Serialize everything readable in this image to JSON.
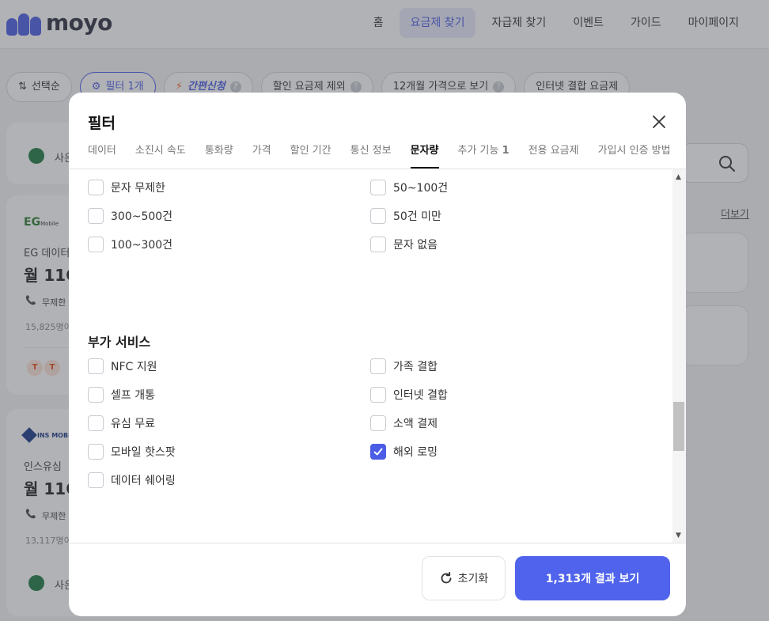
{
  "header": {
    "logo_text": "moyo",
    "nav": [
      {
        "label": "홈",
        "active": false
      },
      {
        "label": "요금제 찾기",
        "active": true
      },
      {
        "label": "자급제 찾기",
        "active": false
      },
      {
        "label": "이벤트",
        "active": false
      },
      {
        "label": "가이드",
        "active": false
      },
      {
        "label": "마이페이지",
        "active": false
      }
    ]
  },
  "chips": {
    "sort": "선택순",
    "filter": "필터 1개",
    "quick_apply": "간편신청",
    "exclude_discount": "할인 요금제 제외",
    "twelve_month": "12개월 가격으로 보기",
    "internet_bundle": "인터넷 결합 요금제"
  },
  "background": {
    "more_link": "더보기",
    "card1": {
      "sponsor_text": "사은"
    },
    "card2": {
      "brand": "EG",
      "brand_sub": "Mobile",
      "name": "EG 데이터",
      "price": "월 11G",
      "feature": "무제한",
      "users": "15,825명이"
    },
    "card3": {
      "brand": "INS MOBI",
      "name": "인스유심 ",
      "price": "월 11G",
      "feature": "무제한",
      "users": "13,117명이",
      "sponsor_text": "사은"
    }
  },
  "modal": {
    "title": "필터",
    "tabs": [
      {
        "label": "데이터",
        "active": false
      },
      {
        "label": "소진시 속도",
        "active": false
      },
      {
        "label": "통화량",
        "active": false
      },
      {
        "label": "가격",
        "active": false
      },
      {
        "label": "할인 기간",
        "active": false
      },
      {
        "label": "통신 정보",
        "active": false
      },
      {
        "label": "문자량",
        "active": true
      },
      {
        "label": "추가 기능",
        "count": "1",
        "active": false
      },
      {
        "label": "전용 요금제",
        "active": false
      },
      {
        "label": "가입시 인증 방법",
        "active": false
      }
    ],
    "sms_options": [
      {
        "label": "문자 무제한",
        "checked": false
      },
      {
        "label": "50~100건",
        "checked": false
      },
      {
        "label": "300~500건",
        "checked": false
      },
      {
        "label": "50건 미만",
        "checked": false
      },
      {
        "label": "100~300건",
        "checked": false
      },
      {
        "label": "문자 없음",
        "checked": false
      }
    ],
    "extra_section_title": "부가 서비스",
    "extra_options": [
      {
        "label": "NFC 지원",
        "checked": false
      },
      {
        "label": "가족 결합",
        "checked": false
      },
      {
        "label": "셀프 개통",
        "checked": false
      },
      {
        "label": "인터넷 결합",
        "checked": false
      },
      {
        "label": "유심 무료",
        "checked": false
      },
      {
        "label": "소액 결제",
        "checked": false
      },
      {
        "label": "모바일 핫스팟",
        "checked": false
      },
      {
        "label": "해외 로밍",
        "checked": true
      },
      {
        "label": "데이터 쉐어링",
        "checked": false
      }
    ],
    "reset_label": "초기화",
    "results_label": "1,313개 결과 보기"
  },
  "colors": {
    "accent": "#4f63ec",
    "brand": "#4b5de6"
  }
}
